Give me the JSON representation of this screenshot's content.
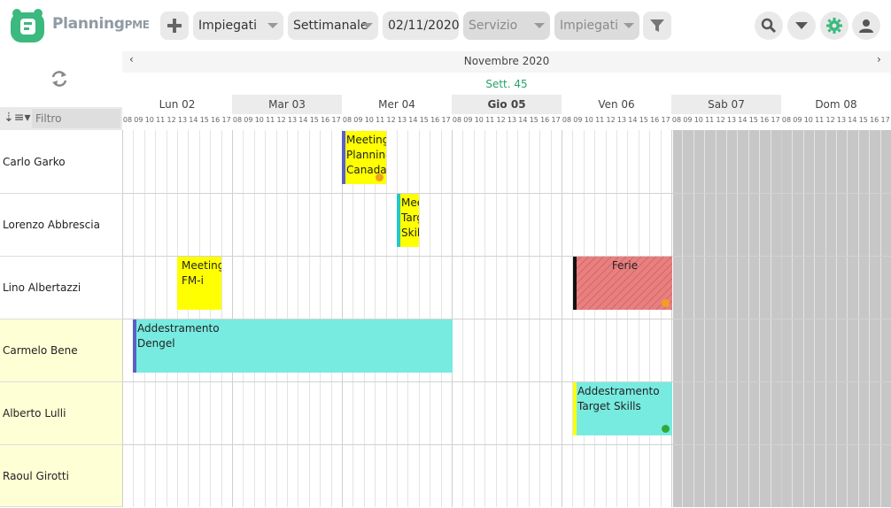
{
  "app": {
    "brand": "Planning",
    "brand_suffix": "PME"
  },
  "toolbar": {
    "view_employees": "Impiegati",
    "period": "Settimanale",
    "date": "02/11/2020",
    "service_placeholder": "Servizio",
    "employees_placeholder": "Impiegati"
  },
  "leftpanel": {
    "filter_placeholder": "Filtro"
  },
  "calendar": {
    "month": "Novembre 2020",
    "week": "Sett. 45",
    "days": [
      "Lun 02",
      "Mar 03",
      "Mer 04",
      "Gio 05",
      "Ven 06",
      "Sab 07",
      "Dom 08"
    ],
    "hours": [
      "08",
      "09",
      "10",
      "11",
      "12",
      "13",
      "14",
      "15",
      "16",
      "17"
    ]
  },
  "resources": [
    "Carlo Garko",
    "Lorenzo Abbrescia",
    "Lino Albertazzi",
    "Carmelo Bene",
    "Alberto Lulli",
    "Raoul Girotti"
  ],
  "events": [
    {
      "line1": "Meeting",
      "line2": "Planning",
      "line3": "Canada"
    },
    {
      "line1": "Meeting",
      "line2": "Target",
      "line3": "Skills"
    },
    {
      "line1": "Meeting",
      "line2": "FM-i"
    },
    {
      "line1": "Ferie"
    },
    {
      "line1": "Addestramento",
      "line2": "Dengel"
    },
    {
      "line1": "Addestramento",
      "line2": "Target Skills"
    }
  ],
  "colors": {
    "accent_green": "#27a36b",
    "logo_green": "#3bb97e",
    "event_yellow": "#ffff00",
    "event_cyan": "#77ebe0",
    "event_red": "#e88080"
  }
}
